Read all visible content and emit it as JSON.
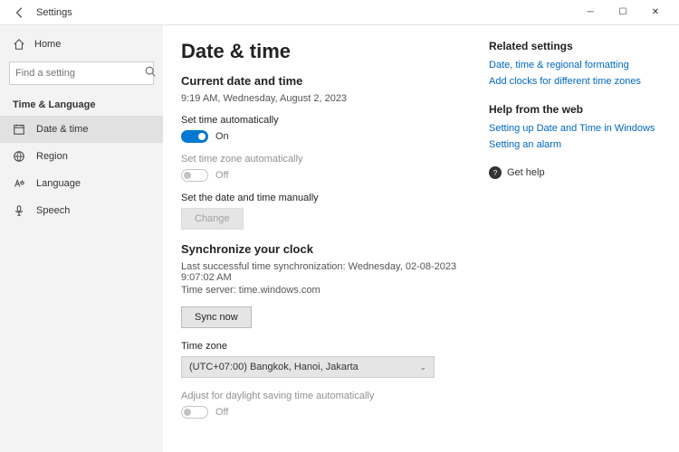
{
  "window": {
    "title": "Settings"
  },
  "sidebar": {
    "home": "Home",
    "search_placeholder": "Find a setting",
    "section": "Time & Language",
    "items": [
      {
        "label": "Date & time"
      },
      {
        "label": "Region"
      },
      {
        "label": "Language"
      },
      {
        "label": "Speech"
      }
    ]
  },
  "page": {
    "heading": "Date & time",
    "current_heading": "Current date and time",
    "current_value": "9:19 AM, Wednesday, August 2, 2023",
    "set_time_auto_label": "Set time automatically",
    "set_time_auto_state": "On",
    "set_tz_auto_label": "Set time zone automatically",
    "set_tz_auto_state": "Off",
    "manual_label": "Set the date and time manually",
    "change_btn": "Change",
    "sync_heading": "Synchronize your clock",
    "sync_last": "Last successful time synchronization: Wednesday, 02-08-2023 9:07:02 AM",
    "sync_server": "Time server: time.windows.com",
    "sync_btn": "Sync now",
    "tz_label": "Time zone",
    "tz_value": "(UTC+07:00) Bangkok, Hanoi, Jakarta",
    "dst_label": "Adjust for daylight saving time automatically",
    "dst_state": "Off"
  },
  "side": {
    "related_heading": "Related settings",
    "related_links": [
      "Date, time & regional formatting",
      "Add clocks for different time zones"
    ],
    "help_heading": "Help from the web",
    "help_links": [
      "Setting up Date and Time in Windows",
      "Setting an alarm"
    ],
    "get_help": "Get help"
  }
}
